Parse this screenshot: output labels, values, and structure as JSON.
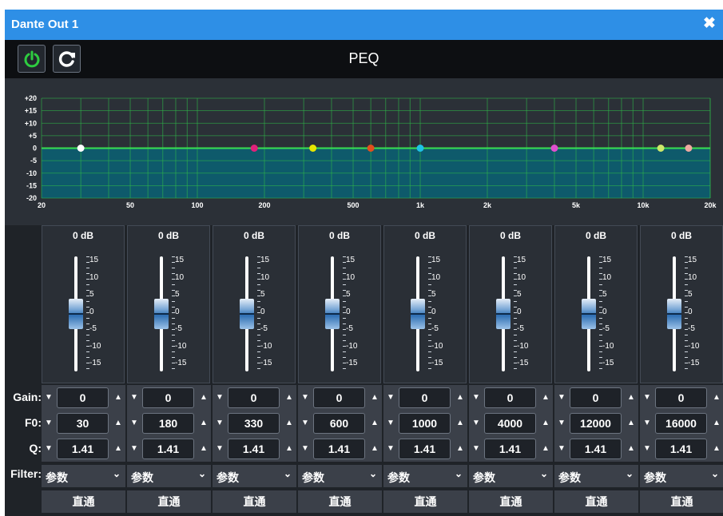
{
  "window": {
    "title": "Dante Out 1",
    "close_icon": "close-x-icon"
  },
  "toolbar": {
    "title": "PEQ",
    "power_icon": "power-icon",
    "reset_icon": "refresh-icon",
    "power_color": "#2ecc40"
  },
  "graph": {
    "y_ticks": [
      "+20",
      "+15",
      "+10",
      "+5",
      "0",
      "-5",
      "-10",
      "-15",
      "-20"
    ],
    "x_ticks": [
      "20",
      "50",
      "100",
      "200",
      "500",
      "1k",
      "2k",
      "5k",
      "10k",
      "20k"
    ],
    "points": [
      {
        "freq": 30,
        "gain": 0,
        "color": "#ffffff"
      },
      {
        "freq": 180,
        "gain": 0,
        "color": "#e0207a"
      },
      {
        "freq": 330,
        "gain": 0,
        "color": "#e6e600"
      },
      {
        "freq": 600,
        "gain": 0,
        "color": "#e34f1c"
      },
      {
        "freq": 1000,
        "gain": 0,
        "color": "#1ec1e6"
      },
      {
        "freq": 4000,
        "gain": 0,
        "color": "#e04fcf"
      },
      {
        "freq": 12000,
        "gain": 0,
        "color": "#cde86a"
      },
      {
        "freq": 16000,
        "gain": 0,
        "color": "#f0a9a0"
      }
    ],
    "grid_color": "#2fb84a",
    "fill_color": "#0e5a6b"
  },
  "labels": {
    "gain": "Gain:",
    "f0": "F0:",
    "q": "Q:",
    "filter": "Filter:"
  },
  "slider_scale": [
    "15",
    "10",
    "5",
    "0",
    "-5",
    "-10",
    "-15"
  ],
  "bands": [
    {
      "gain_db": "0 dB",
      "gain": "0",
      "f0": "30",
      "q": "1.41",
      "filter": "参数",
      "bypass": "直通"
    },
    {
      "gain_db": "0 dB",
      "gain": "0",
      "f0": "180",
      "q": "1.41",
      "filter": "参数",
      "bypass": "直通"
    },
    {
      "gain_db": "0 dB",
      "gain": "0",
      "f0": "330",
      "q": "1.41",
      "filter": "参数",
      "bypass": "直通"
    },
    {
      "gain_db": "0 dB",
      "gain": "0",
      "f0": "600",
      "q": "1.41",
      "filter": "参数",
      "bypass": "直通"
    },
    {
      "gain_db": "0 dB",
      "gain": "0",
      "f0": "1000",
      "q": "1.41",
      "filter": "参数",
      "bypass": "直通"
    },
    {
      "gain_db": "0 dB",
      "gain": "0",
      "f0": "4000",
      "q": "1.41",
      "filter": "参数",
      "bypass": "直通"
    },
    {
      "gain_db": "0 dB",
      "gain": "0",
      "f0": "12000",
      "q": "1.41",
      "filter": "参数",
      "bypass": "直通"
    },
    {
      "gain_db": "0 dB",
      "gain": "0",
      "f0": "16000",
      "q": "1.41",
      "filter": "参数",
      "bypass": "直通"
    }
  ]
}
